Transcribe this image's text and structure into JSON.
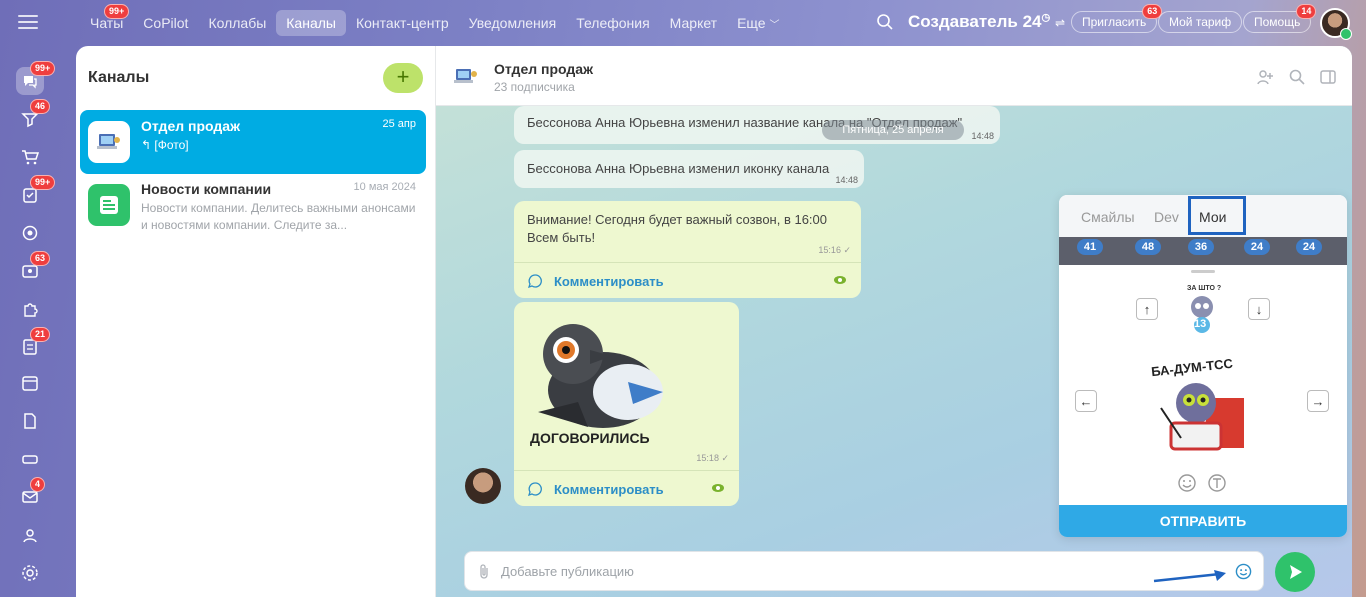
{
  "topbar": {
    "nav": [
      {
        "label": "Чаты",
        "badge": "99+"
      },
      {
        "label": "CoPilot"
      },
      {
        "label": "Коллабы"
      },
      {
        "label": "Каналы",
        "active": true
      },
      {
        "label": "Контакт-центр"
      },
      {
        "label": "Уведомления"
      },
      {
        "label": "Телефония"
      },
      {
        "label": "Маркет"
      },
      {
        "label": "Еще"
      }
    ],
    "brand": "Создаватель",
    "brand_num": "24",
    "invite_label": "Пригласить",
    "invite_badge": "63",
    "tariff_label": "Мой тариф",
    "help_label": "Помощь",
    "help_badge": "14"
  },
  "leftnav": {
    "badges": {
      "chat": "99+",
      "feed": "46",
      "tasks": "99+",
      "groups": "63",
      "docs": "21",
      "mail": "4"
    },
    "icons": [
      "chat-icon",
      "feed-icon",
      "cart-icon",
      "tasks-icon",
      "target-icon",
      "groups-icon",
      "puzzle-icon",
      "docs-icon",
      "calendar-icon",
      "document-icon",
      "drive-icon",
      "mail-icon",
      "users-icon",
      "settings-icon"
    ]
  },
  "channels": {
    "title": "Каналы",
    "add": "+",
    "items": [
      {
        "name": "Отдел продаж",
        "date": "25 апр",
        "preview": "↰ [Фото]"
      },
      {
        "name": "Новости компании",
        "date": "10 мая 2024",
        "preview": "Новости компании. Делитесь важными анонсами и новостями компании. Следите за..."
      }
    ]
  },
  "chat": {
    "title": "Отдел продаж",
    "subtitle": "23 подписчика",
    "date_chip": "Пятница, 25 апреля",
    "messages": [
      {
        "text": "Бессонова Анна Юрьевна изменил название канала на \"Отдел продаж\"",
        "time": "14:48"
      },
      {
        "text": "Бессонова Анна Юрьевна изменил иконку канала",
        "time": "14:48"
      },
      {
        "text": "Внимание! Сегодня будет важный созвон, в 16:00\nВсем быть!",
        "time": "15:16"
      },
      {
        "sticker_caption": "ДОГОВОРИЛИСЬ",
        "time": "15:18"
      }
    ],
    "comment_label": "Комментировать",
    "input_placeholder": "Добавьте публикацию"
  },
  "sticker_panel": {
    "tabs": [
      "Смайлы",
      "Dev",
      "Мои"
    ],
    "strip_numbers": [
      "41",
      "48",
      "36",
      "24",
      "24"
    ],
    "small_caption": "ЗА ШТО ?",
    "small_num": "13",
    "big_caption": "БА-ДУМ-ТСС",
    "send_label": "ОТПРАВИТЬ"
  },
  "colors": {
    "accent": "#00ace3",
    "green": "#2fc26b",
    "add_bg": "#bde26a",
    "send": "#2fa9e6",
    "badge": "#ef3e3e"
  }
}
